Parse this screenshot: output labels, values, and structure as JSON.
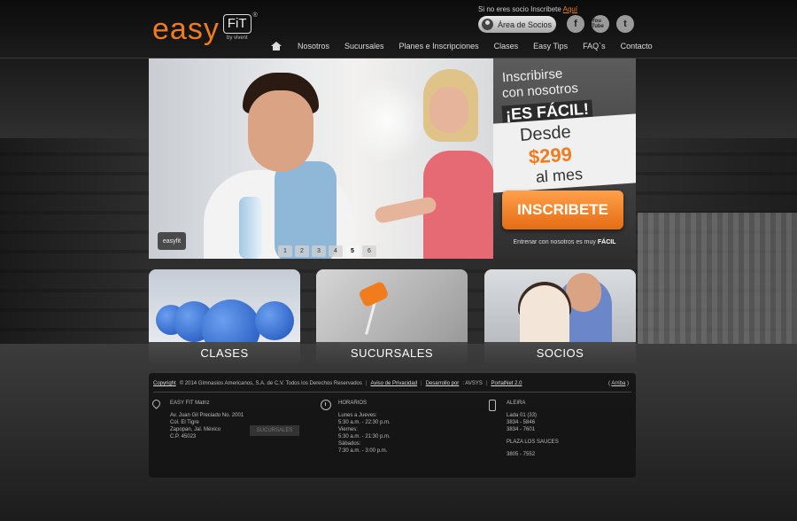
{
  "header": {
    "logo_main": "easy",
    "logo_fit": "FiT",
    "logo_sub": "by vivent",
    "logo_reg": "®",
    "top_note": "Si no eres socio Inscribete",
    "top_note_link": "Aquí",
    "socios_button": "Área de Socios",
    "social": {
      "facebook": "f",
      "youtube": "You Tube",
      "twitter": "t"
    },
    "nav": [
      "Nosotros",
      "Sucursales",
      "Planes e Inscripciones",
      "Clases",
      "Easy Tips",
      "FAQ`s",
      "Contacto"
    ]
  },
  "hero": {
    "badge": "easyfit",
    "pages": [
      "1",
      "2",
      "3",
      "4",
      "5",
      "6"
    ],
    "active_page": "5",
    "promo": {
      "line1": "Inscribirse",
      "line2": "con nosotros",
      "facil": "¡ES FÁCIL!",
      "desde": "Desde",
      "price": "$299",
      "mes": "al mes",
      "button": "INSCRIBETE",
      "foot_text": "Entrenar con nosotros es muy",
      "foot_bold": "FÁCIL"
    }
  },
  "features": [
    {
      "label": "CLASES"
    },
    {
      "label": "SUCURSALES"
    },
    {
      "label": "SOCIOS"
    }
  ],
  "footer": {
    "copyright_link": "Copyright",
    "copyright_text": "© 2014 Gimnasios Americanos, S.A. de C.V. Todos los Derechos Reservados",
    "aviso": "Aviso de Privacidad",
    "desarrollo": "Desarrollo por",
    "desarrollo_by": ": AVSYS",
    "portalnet": "PortalNet 2.0",
    "arriba_prefix": "(",
    "arriba": "Arriba",
    "arriba_suffix": ")",
    "col1": {
      "title": "EASY FIT Matriz",
      "lines": [
        "Av. Juan Gil Preciado No. 2001",
        "Col. El Tigre",
        "Zapopan, Jal. México",
        "C.P. 45023"
      ],
      "button": "SUCURSALES"
    },
    "col2": {
      "title": "HORARIOS",
      "lines": [
        "Lunes a Jueves:",
        "5:30 a.m. - 22:30 p.m.",
        "Viernes:",
        "5:30 a.m. - 21:30 p.m.",
        "Sábados:",
        "7:30 a.m. - 3:00 p.m."
      ]
    },
    "col3": {
      "title": "ALEIRA",
      "lines": [
        "Lada 01 (33)",
        "3834 - 5846",
        "3834 - 7601"
      ],
      "title2": "PLAZA LOS SAUCES",
      "line2": "3805 - 7552"
    }
  },
  "colors": {
    "accent": "#f07c1e",
    "background": "#2a2a2a"
  }
}
